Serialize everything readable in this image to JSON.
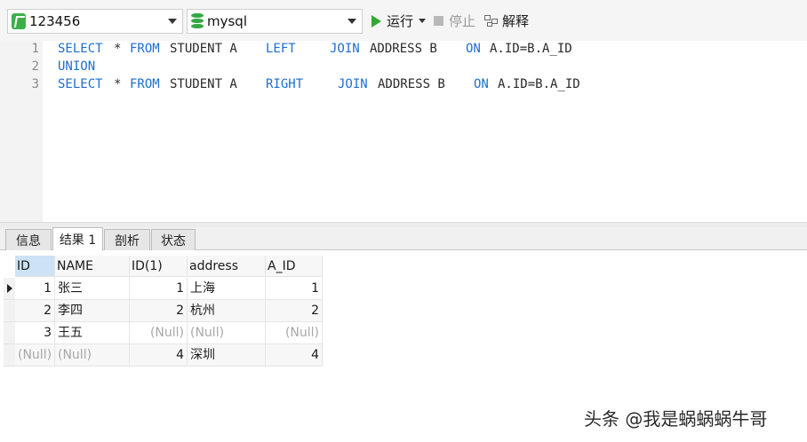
{
  "toolbar": {
    "connection": {
      "value": "123456",
      "icon": "connection-icon"
    },
    "database": {
      "value": "mysql",
      "icon": "database-icon"
    },
    "run_label": "运行",
    "stop_label": "停止",
    "explain_label": "解释"
  },
  "editor": {
    "line_numbers": [
      "1",
      "2",
      "3"
    ],
    "lines": [
      {
        "select": "SELECT",
        "star": "*",
        "from": "FROM",
        "table": "STUDENT A",
        "join_type": "LEFT",
        "join": "JOIN",
        "table2": "ADDRESS B",
        "on": "ON",
        "cond": "A.ID=B.A_ID"
      },
      {
        "union": "UNION"
      },
      {
        "select": "SELECT",
        "star": "*",
        "from": "FROM",
        "table": "STUDENT A",
        "join_type": "RIGHT",
        "join": "JOIN",
        "table2": "ADDRESS B",
        "on": "ON",
        "cond": "A.ID=B.A_ID"
      }
    ]
  },
  "tabs": [
    {
      "label": "信息"
    },
    {
      "label": "结果 1",
      "active": true
    },
    {
      "label": "剖析"
    },
    {
      "label": "状态"
    }
  ],
  "results": {
    "columns": [
      "ID",
      "NAME",
      "ID(1)",
      "address",
      "A_ID"
    ],
    "rows": [
      [
        "1",
        "张三",
        "1",
        "上海",
        "1"
      ],
      [
        "2",
        "李四",
        "2",
        "杭州",
        "2"
      ],
      [
        "3",
        "王五",
        "(Null)",
        "(Null)",
        "(Null)"
      ],
      [
        "(Null)",
        "(Null)",
        "4",
        "深圳",
        "4"
      ]
    ]
  },
  "watermark": "头条 @我是蜗蜗蜗牛哥",
  "colors": {
    "keyword": "#1c6fd0",
    "run_green": "#33a833",
    "null_text": "#a8a8a8"
  }
}
